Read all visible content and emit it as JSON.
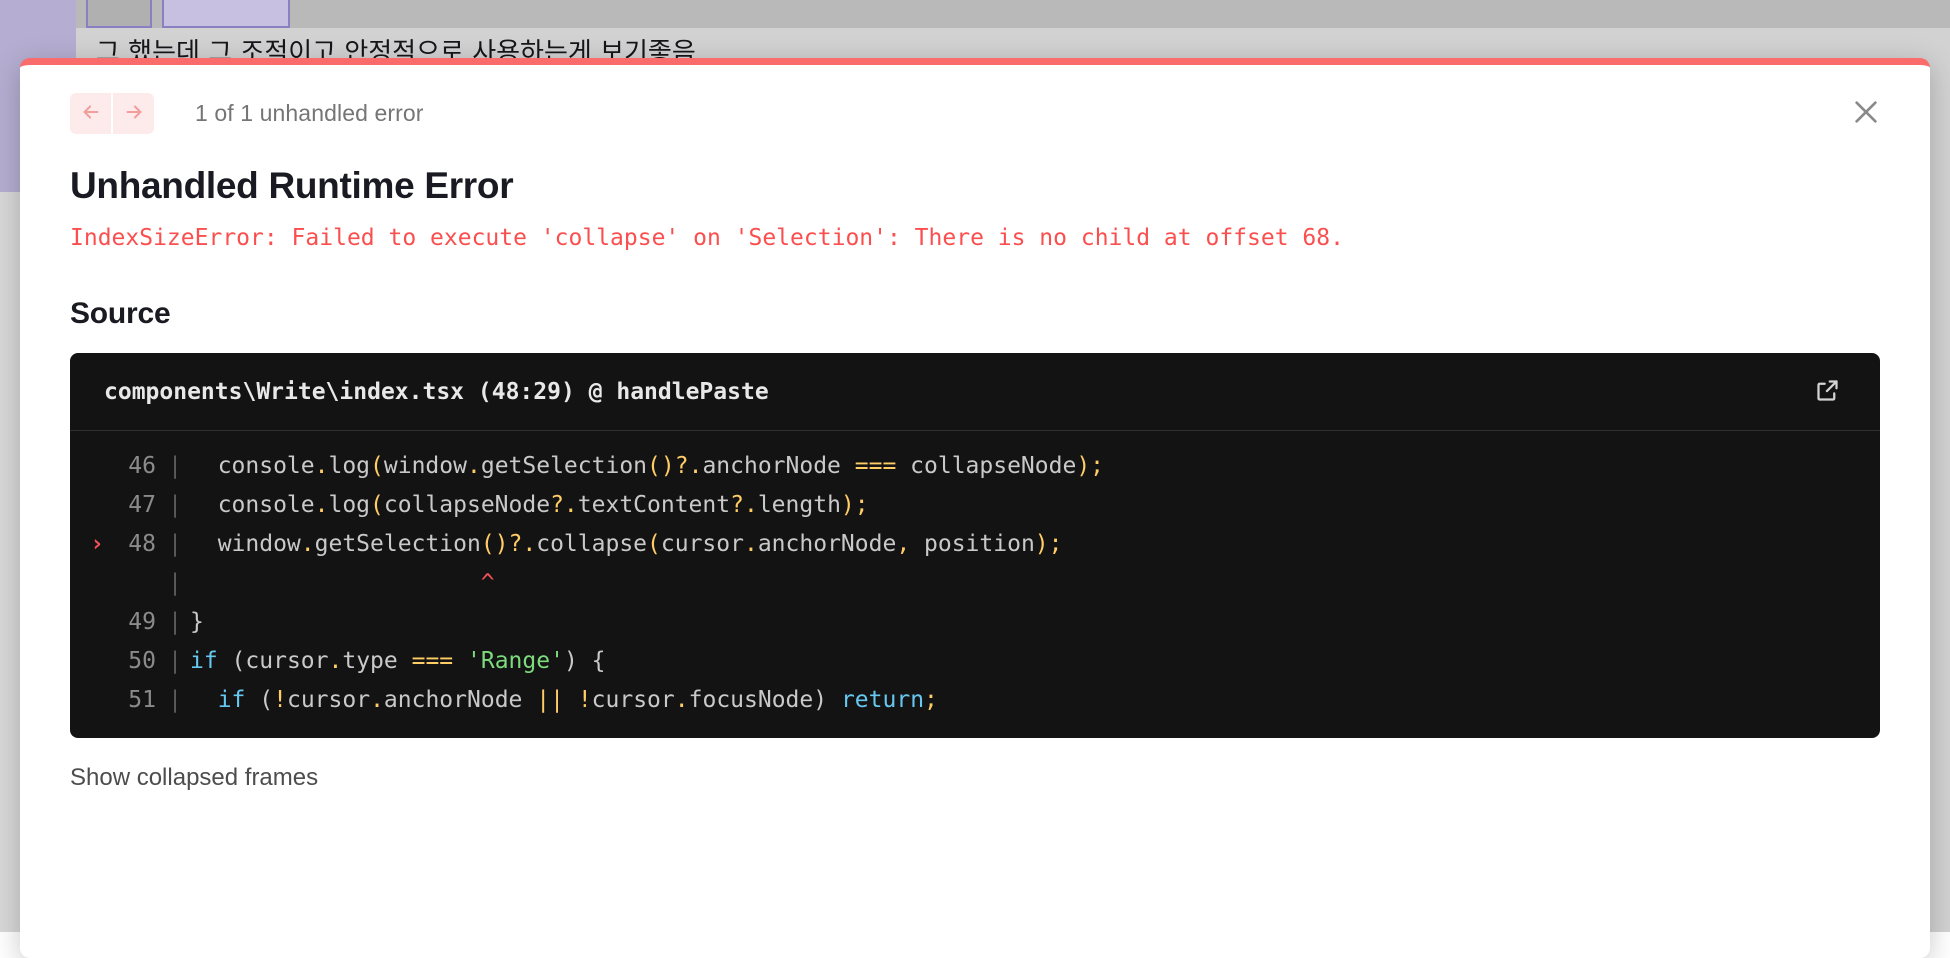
{
  "background": {
    "tabs": [
      {
        "label": ""
      },
      {
        "label": ""
      }
    ],
    "content_text": "그 했는데 그 조적이고 안정적으로 사용하는게 보기좋음"
  },
  "dialog": {
    "accent_color": "#fa6b6b",
    "nav": {
      "prev_icon": "arrow-left-icon",
      "next_icon": "arrow-right-icon"
    },
    "error_count": "1 of 1 unhandled error",
    "close_icon": "close-icon",
    "title": "Unhandled Runtime Error",
    "message": "IndexSizeError: Failed to execute 'collapse' on 'Selection': There is no child at offset 68.",
    "message_color": "#fb4f4f",
    "source_heading": "Source",
    "show_frames_label": "Show collapsed frames"
  },
  "code": {
    "file_path": "components\\Write\\index.tsx (48:29) @ handlePaste",
    "open_external_icon": "external-link-icon",
    "bar": "|",
    "error_marker": "›",
    "lines": [
      {
        "number": "46",
        "marked": false,
        "tokens": [
          {
            "t": "  console",
            "c": "pl"
          },
          {
            "t": ".",
            "c": "op"
          },
          {
            "t": "log",
            "c": "pl"
          },
          {
            "t": "(",
            "c": "op"
          },
          {
            "t": "window",
            "c": "pl"
          },
          {
            "t": ".",
            "c": "op"
          },
          {
            "t": "getSelection",
            "c": "pl"
          },
          {
            "t": "()",
            "c": "op"
          },
          {
            "t": "?",
            "c": "op"
          },
          {
            "t": ".",
            "c": "op"
          },
          {
            "t": "anchorNode ",
            "c": "pl"
          },
          {
            "t": "===",
            "c": "op"
          },
          {
            "t": " collapseNode",
            "c": "pl"
          },
          {
            "t": ");",
            "c": "op"
          }
        ]
      },
      {
        "number": "47",
        "marked": false,
        "tokens": [
          {
            "t": "  console",
            "c": "pl"
          },
          {
            "t": ".",
            "c": "op"
          },
          {
            "t": "log",
            "c": "pl"
          },
          {
            "t": "(",
            "c": "op"
          },
          {
            "t": "collapseNode",
            "c": "pl"
          },
          {
            "t": "?",
            "c": "op"
          },
          {
            "t": ".",
            "c": "op"
          },
          {
            "t": "textContent",
            "c": "pl"
          },
          {
            "t": "?",
            "c": "op"
          },
          {
            "t": ".",
            "c": "op"
          },
          {
            "t": "length",
            "c": "pl"
          },
          {
            "t": ");",
            "c": "op"
          }
        ]
      },
      {
        "number": "48",
        "marked": true,
        "tokens": [
          {
            "t": "  window",
            "c": "pl"
          },
          {
            "t": ".",
            "c": "op"
          },
          {
            "t": "getSelection",
            "c": "pl"
          },
          {
            "t": "()",
            "c": "op"
          },
          {
            "t": "?",
            "c": "op"
          },
          {
            "t": ".",
            "c": "op"
          },
          {
            "t": "collapse",
            "c": "pl"
          },
          {
            "t": "(",
            "c": "op"
          },
          {
            "t": "cursor",
            "c": "pl"
          },
          {
            "t": ".",
            "c": "op"
          },
          {
            "t": "anchorNode",
            "c": "pl"
          },
          {
            "t": ",",
            "c": "op"
          },
          {
            "t": " position",
            "c": "pl"
          },
          {
            "t": ");",
            "c": "op"
          }
        ]
      },
      {
        "number": "",
        "marked": false,
        "tokens": [
          {
            "t": "                     ",
            "c": "pl"
          },
          {
            "t": "^",
            "c": "car"
          }
        ]
      },
      {
        "number": "49",
        "marked": false,
        "tokens": [
          {
            "t": "}",
            "c": "pl"
          }
        ]
      },
      {
        "number": "50",
        "marked": false,
        "tokens": [
          {
            "t": "if",
            "c": "kw"
          },
          {
            "t": " (",
            "c": "pl"
          },
          {
            "t": "cursor",
            "c": "pl"
          },
          {
            "t": ".",
            "c": "op"
          },
          {
            "t": "type ",
            "c": "pl"
          },
          {
            "t": "===",
            "c": "op"
          },
          {
            "t": " ",
            "c": "pl"
          },
          {
            "t": "'Range'",
            "c": "str"
          },
          {
            "t": ") {",
            "c": "pl"
          }
        ]
      },
      {
        "number": "51",
        "marked": false,
        "tokens": [
          {
            "t": "  ",
            "c": "pl"
          },
          {
            "t": "if",
            "c": "kw"
          },
          {
            "t": " (",
            "c": "pl"
          },
          {
            "t": "!",
            "c": "op"
          },
          {
            "t": "cursor",
            "c": "pl"
          },
          {
            "t": ".",
            "c": "op"
          },
          {
            "t": "anchorNode ",
            "c": "pl"
          },
          {
            "t": "||",
            "c": "op"
          },
          {
            "t": " ",
            "c": "pl"
          },
          {
            "t": "!",
            "c": "op"
          },
          {
            "t": "cursor",
            "c": "pl"
          },
          {
            "t": ".",
            "c": "op"
          },
          {
            "t": "focusNode",
            "c": "pl"
          },
          {
            "t": ") ",
            "c": "pl"
          },
          {
            "t": "return",
            "c": "kw"
          },
          {
            "t": ";",
            "c": "op"
          }
        ]
      }
    ]
  }
}
